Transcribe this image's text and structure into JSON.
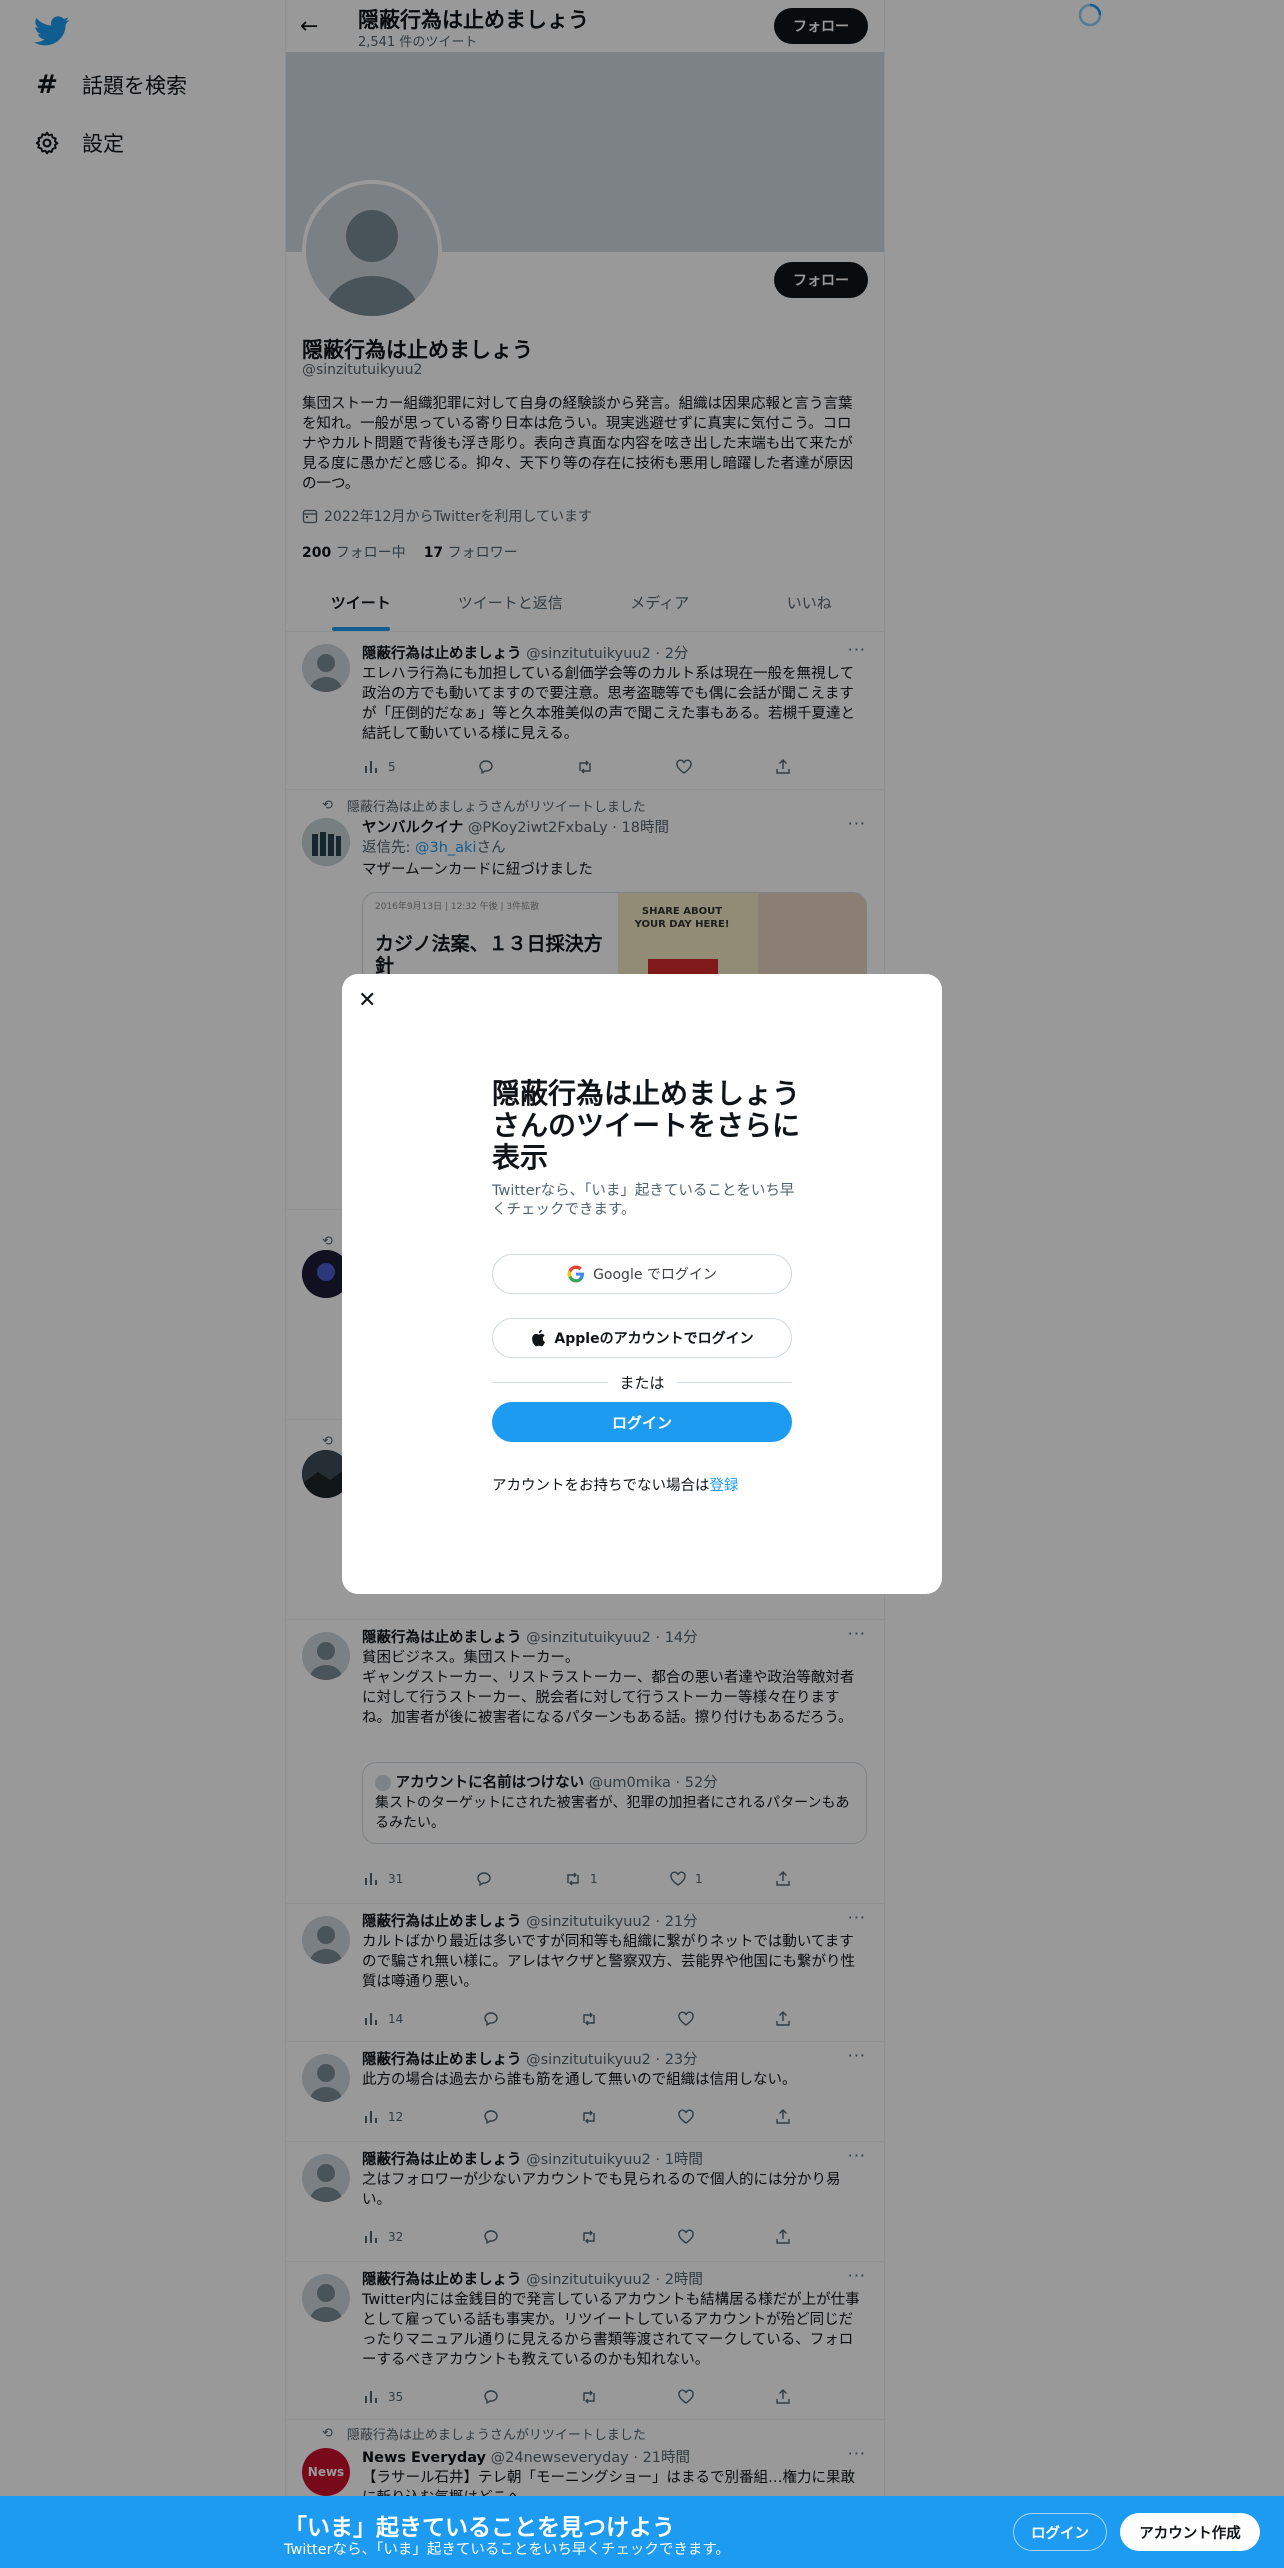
{
  "nav": {
    "items": [
      {
        "label": "話題を検索",
        "icon": "hashtag-icon"
      },
      {
        "label": "設定",
        "icon": "gear-icon"
      }
    ]
  },
  "header": {
    "title": "隠蔽行為は止めましょう",
    "tweet_count": "2,541 件のツイート",
    "follow_label": "フォロー"
  },
  "profile": {
    "name": "隠蔽行為は止めましょう",
    "handle": "@sinzitutuikyuu2",
    "follow_label": "フォロー",
    "bio": "集団ストーカー組織犯罪に対して自身の経験談から発言。組織は因果応報と言う言葉を知れ。一般が思っている寄り日本は危うい。現実逃避せずに真実に気付こう。コロナやカルト問題で背後も浮き彫り。表向き真面な内容を呟き出した末端も出て来たが見る度に愚かだと感じる。抑々、天下り等の存在に技術も悪用し暗躍した者達が原因の一つ。",
    "joined": "2022年12月からTwitterを利用しています",
    "following_count": "200",
    "following_label": "フォロー中",
    "followers_count": "17",
    "followers_label": "フォロワー"
  },
  "tabs": [
    "ツイート",
    "ツイートと返信",
    "メディア",
    "いいね"
  ],
  "tweets": [
    {
      "name": "隠蔽行為は止めましょう",
      "handle": "@sinzitutuikyuu2",
      "time": "2分",
      "text": "エレハラ行為にも加担している創価学会等のカルト系は現在一般を無視して政治の方でも動いてますので要注意。思考盗聴等でも偶に会話が聞こえますが「圧倒的だなぁ」等と久本雅美似の声で聞こえた事もある。若槻千夏達と結託して動いている様に見える。",
      "views": "5",
      "retweets": "",
      "likes": ""
    },
    {
      "retweet_by": "隠蔽行為は止めましょうさんがリツイートしました",
      "name": "ヤンバルクイナ",
      "handle": "@PKoy2iwt2FxbaLy",
      "time": "18時間",
      "reply_to_prefix": "返信先: ",
      "reply_to": "@3h_aki",
      "reply_to_suffix": "さん",
      "text": "マザームーンカードに紐づけました",
      "card_date": "2016年9月13日 | 12:32 午後 | 3件拡散",
      "card_title": "カジノ法案、１３日採決方針",
      "card_ad": "SHARE ABOUT YOUR DAY HERE!"
    },
    {
      "name": "隠蔽行為は止めましょう",
      "handle": "@sinzitutuikyuu2",
      "time": "14分",
      "text": "貧困ビジネス。集団ストーカー。\nギャングストーカー、リストラストーカー、都合の悪い者達や政治等敵対者に対して行うストーカー、脱会者に対して行うストーカー等様々在りますね。加害者が後に被害者になるパターンもある話。擦り付けもあるだろう。",
      "quote_name": "アカウントに名前はつけない",
      "quote_handle": "@um0mika",
      "quote_time": "52分",
      "quote_text": "集ストのターゲットにされた被害者が、犯罪の加担者にされるパターンもあるみたい。",
      "views": "31",
      "retweets": "1",
      "likes": "1"
    },
    {
      "name": "隠蔽行為は止めましょう",
      "handle": "@sinzitutuikyuu2",
      "time": "21分",
      "text": "カルトばかり最近は多いですが同和等も組織に繋がりネットでは動いてますので騙され無い様に。アレはヤクザと警察双方、芸能界や他国にも繋がり性質は噂通り悪い。",
      "views": "14"
    },
    {
      "name": "隠蔽行為は止めましょう",
      "handle": "@sinzitutuikyuu2",
      "time": "23分",
      "text": "此方の場合は過去から誰も筋を通して無いので組織は信用しない。",
      "views": "12"
    },
    {
      "name": "隠蔽行為は止めましょう",
      "handle": "@sinzitutuikyuu2",
      "time": "1時間",
      "text": "之はフォロワーが少ないアカウントでも見られるので個人的には分かり易い。",
      "views": "32"
    },
    {
      "name": "隠蔽行為は止めましょう",
      "handle": "@sinzitutuikyuu2",
      "time": "2時間",
      "text": "Twitter内には金銭目的で発言しているアカウントも結構居る様だが上が仕事として雇っている話も事実か。リツイートしているアカウントが殆ど同じだったりマニュアル通りに見えるから書類等渡されてマークしている、フォローするべきアカウントも教えているのかも知れない。",
      "views": "35"
    },
    {
      "retweet_by": "隠蔽行為は止めましょうさんがリツイートしました",
      "name": "News Everyday",
      "handle": "@24newseveryday",
      "time": "21時間",
      "avatar_text": "News",
      "text": "【ラサール石井】テレ朝「モーニングショー」はまるで別番組…権力に果敢に斬り込む気概はどこへ"
    }
  ],
  "modal": {
    "title": "隠蔽行為は止めましょうさんのツイートをさらに表示",
    "subtitle": "Twitterなら、「いま」起きていることをいち早くチェックできます。",
    "google_label": "Google でログイン",
    "apple_label": "Appleのアカウントでログイン",
    "or_label": "または",
    "login_label": "ログイン",
    "signup_prompt": "アカウントをお持ちでない場合は",
    "signup_link": "登録"
  },
  "bottom_bar": {
    "title": "「いま」起きていることを見つけよう",
    "subtitle": "Twitterなら、「いま」起きていることをいち早くチェックできます。",
    "login_label": "ログイン",
    "signup_label": "アカウント作成"
  },
  "colors": {
    "accent": "#1d9bf0",
    "dark": "#0f1419",
    "muted": "#536471"
  }
}
